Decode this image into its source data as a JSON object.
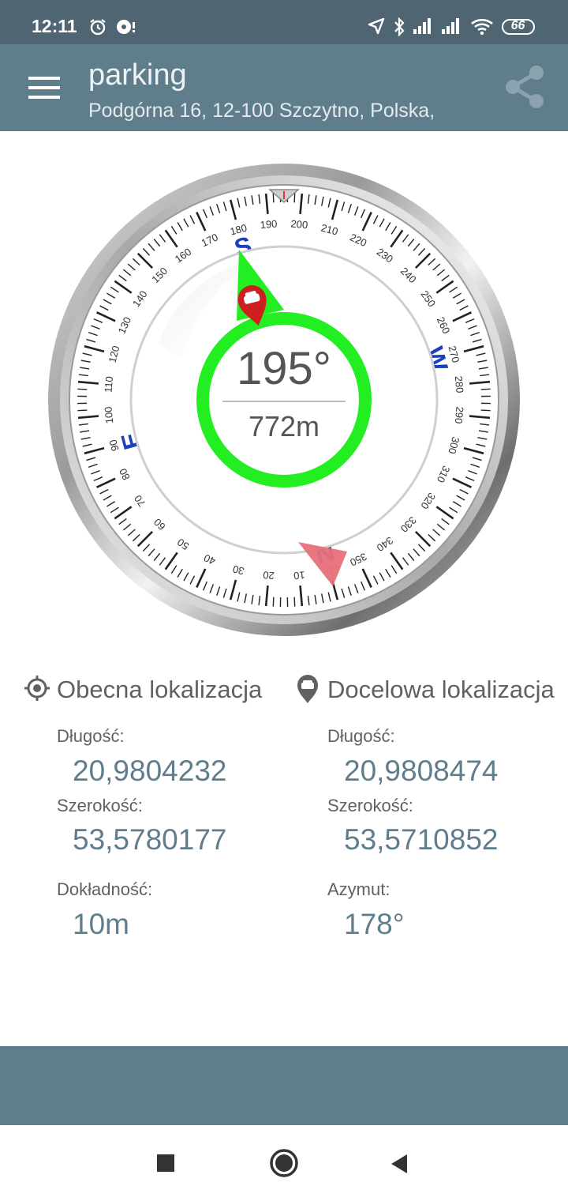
{
  "status_bar": {
    "time": "12:11",
    "battery": "66",
    "icons": [
      "alarm-icon",
      "app-notification-icon",
      "location-arrow-icon",
      "bluetooth-icon",
      "signal-icon",
      "signal-icon",
      "wifi-icon",
      "battery-icon"
    ]
  },
  "app_bar": {
    "title": "parking",
    "subtitle": "Podgórna 16, 12-100 Szczytno, Polska,",
    "icons": [
      "menu-icon",
      "share-icon"
    ]
  },
  "compass": {
    "bearing": "195°",
    "distance": "772m",
    "heading_deg": 195,
    "cardinals": [
      "N",
      "E",
      "S",
      "W"
    ],
    "tick_labels": [
      "0",
      "10",
      "20",
      "30",
      "40",
      "50",
      "60",
      "70",
      "80",
      "90",
      "100",
      "110",
      "120",
      "130",
      "140",
      "150",
      "160",
      "170",
      "180",
      "190",
      "200",
      "210",
      "220",
      "230",
      "240",
      "250",
      "260",
      "270",
      "280",
      "290",
      "300",
      "310",
      "320",
      "330",
      "340",
      "350"
    ],
    "colors": {
      "ring": "#22ee22",
      "north_marker": "#e8707a",
      "cardinal": "#1a3fbf",
      "pin": "#cc1f1f"
    }
  },
  "current_location": {
    "heading": "Obecna lokalizacja",
    "lon_label": "Długość:",
    "lon_value": "20,9804232",
    "lat_label": "Szerokość:",
    "lat_value": "53,5780177",
    "acc_label": "Dokładność:",
    "acc_value": "10m"
  },
  "target_location": {
    "heading": "Docelowa lokalizacja",
    "lon_label": "Długość:",
    "lon_value": "20,9808474",
    "lat_label": "Szerokość:",
    "lat_value": "53,5710852",
    "az_label": "Azymut:",
    "az_value": "178°"
  },
  "nav_bar": {
    "icons": [
      "recents-icon",
      "home-icon",
      "back-icon"
    ]
  }
}
